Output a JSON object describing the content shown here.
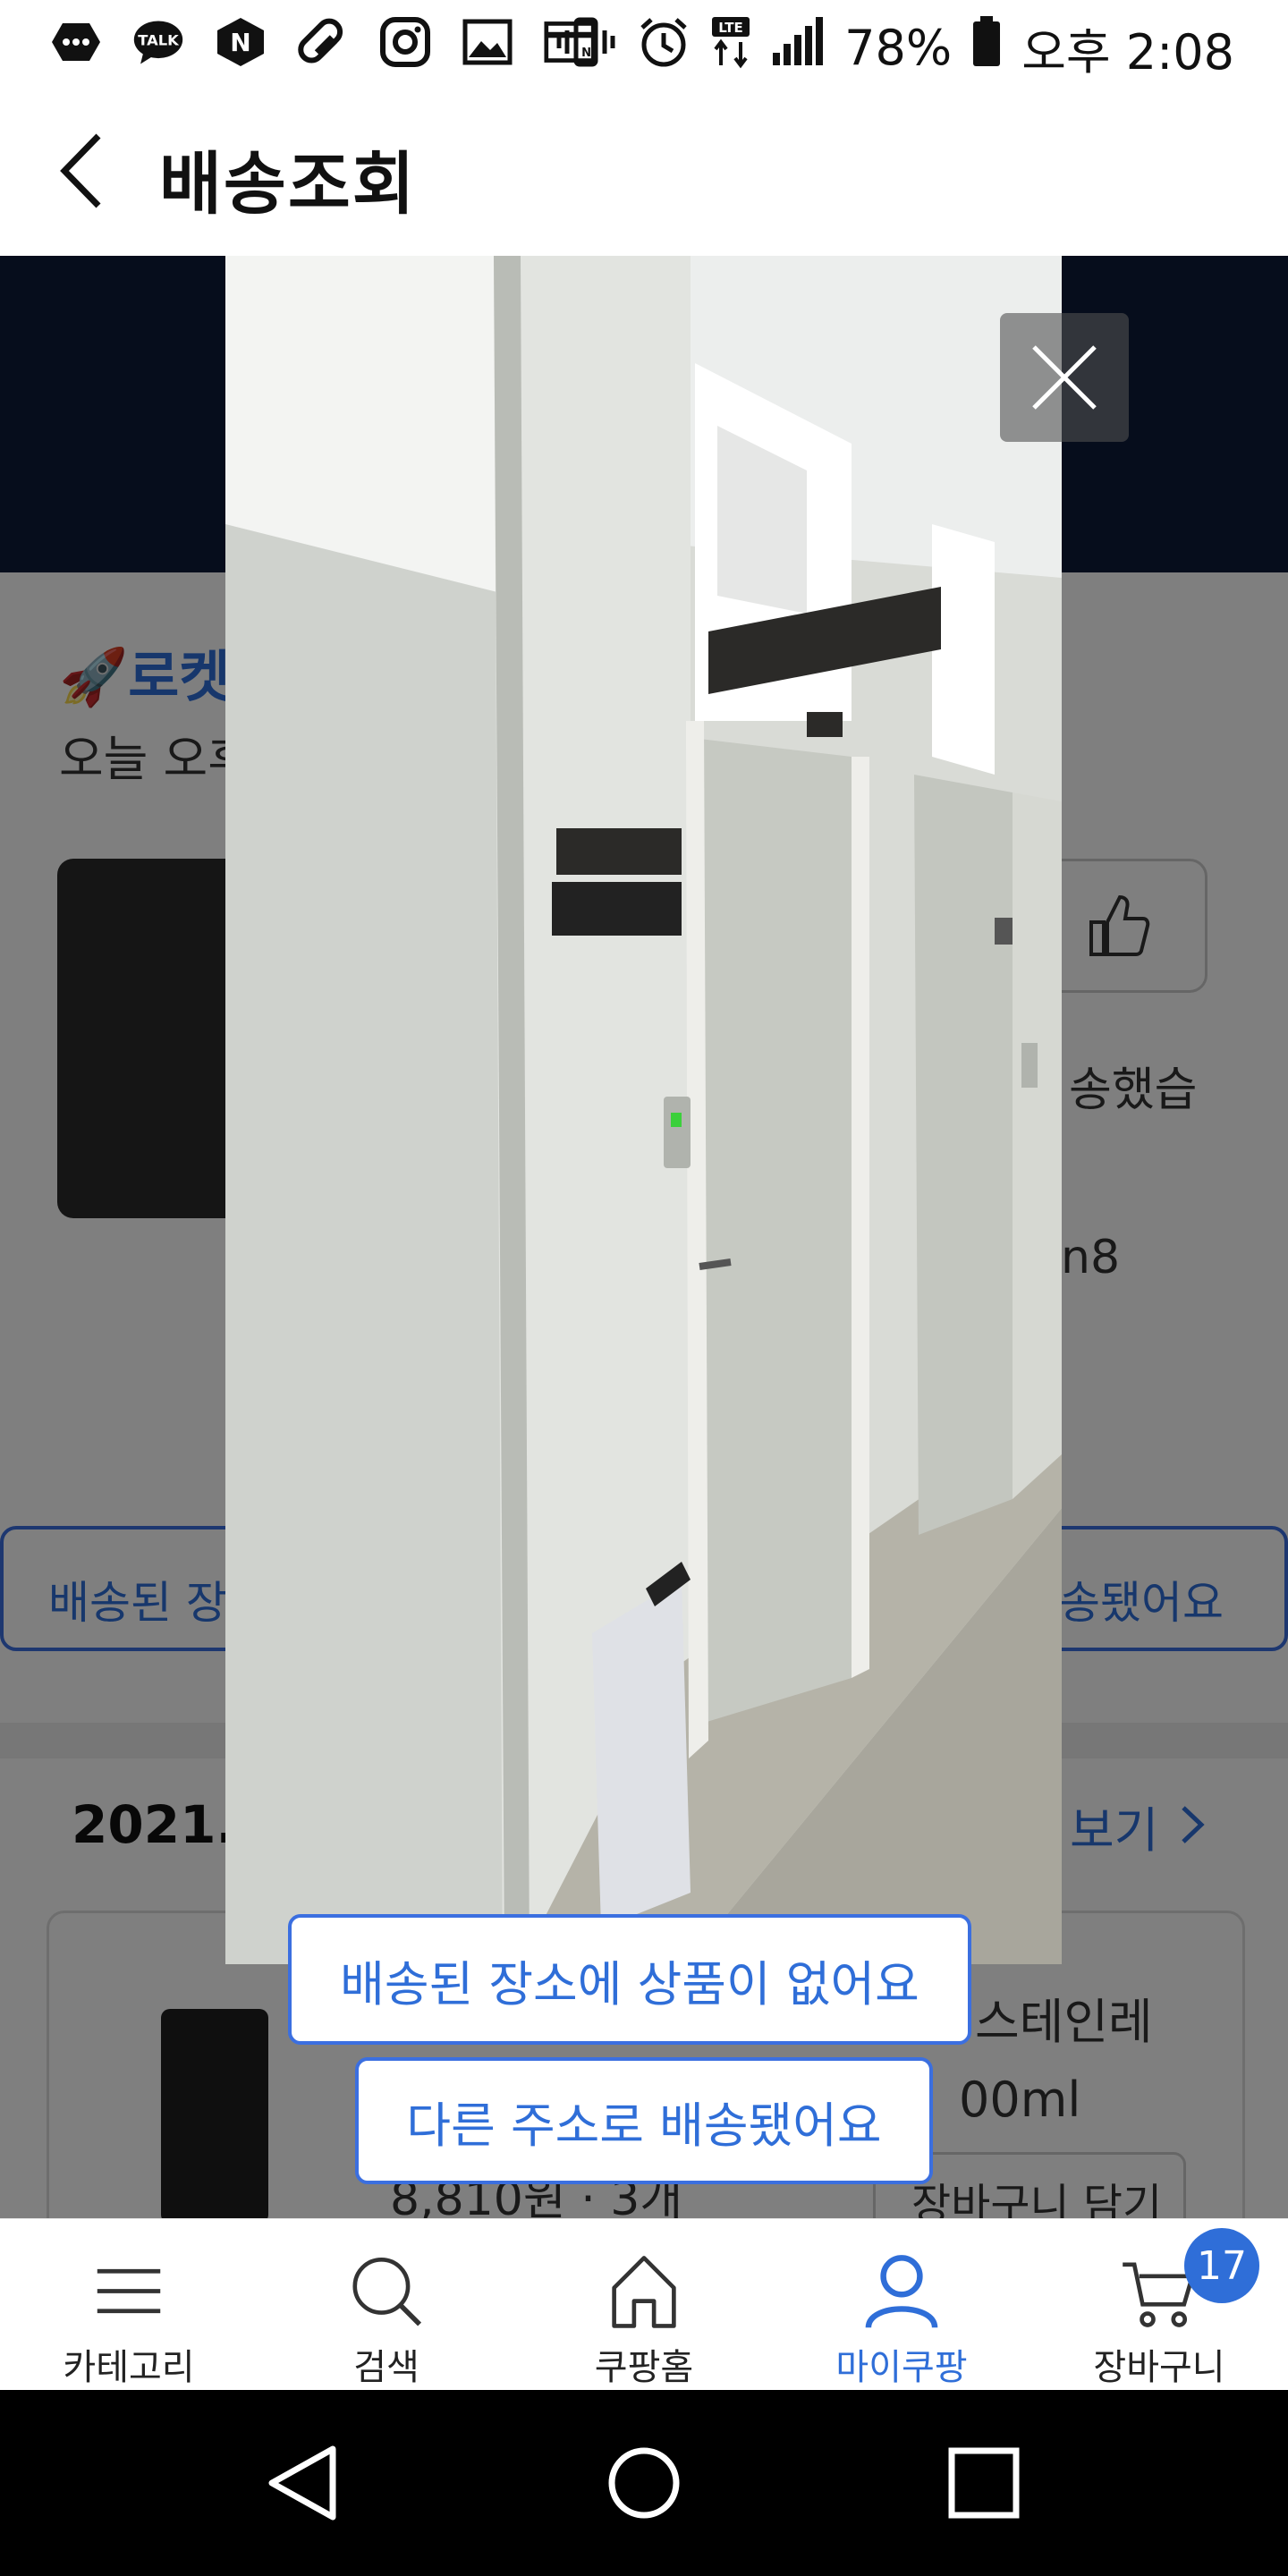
{
  "status_bar": {
    "battery": "78%",
    "time": "오후 2:08",
    "notification_icons": [
      "chat-bubble-icon",
      "talk-icon",
      "naver-icon",
      "pill-icon",
      "instagram-icon",
      "gallery-icon",
      "card-icon"
    ],
    "system_icons": [
      "vibrate-icon",
      "alarm-icon",
      "lte-icon",
      "signal-icon",
      "battery-icon"
    ]
  },
  "header": {
    "title": "배송조회",
    "back_icon": "chevron-left-icon"
  },
  "background_page": {
    "rocket_text": "로켓",
    "eta_text": "오늘 오후",
    "delivered_fragment": "송했습",
    "code_fragment": "n8",
    "btn_left": "배송된 장",
    "btn_right": "송됐어요",
    "order_date": "2021.",
    "view_more": "보기",
    "product_name_1": "스테인레",
    "product_name_2": "00ml",
    "product_price": "8,810원 · 3개",
    "add_to_cart": "장바구니 담기"
  },
  "photo_viewer": {
    "close_icon": "close-icon",
    "report_buttons": {
      "not_found": "배송된 장소에 상품이 없어요",
      "other_address": "다른 주소로 배송됐어요"
    }
  },
  "bottom_nav": {
    "items": [
      {
        "label": "카테고리",
        "icon": "menu-icon"
      },
      {
        "label": "검색",
        "icon": "search-icon"
      },
      {
        "label": "쿠팡홈",
        "icon": "home-icon"
      },
      {
        "label": "마이쿠팡",
        "icon": "user-icon"
      },
      {
        "label": "장바구니",
        "icon": "cart-icon"
      }
    ],
    "active_index": 3,
    "cart_count": "17",
    "accent_color": "#2f6ed8"
  },
  "system_nav": {
    "buttons": [
      "back-triangle-icon",
      "home-circle-icon",
      "recents-square-icon"
    ]
  }
}
